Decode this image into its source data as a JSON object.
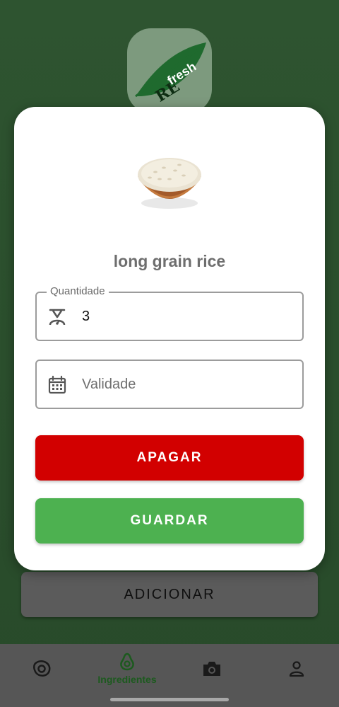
{
  "modal": {
    "item_name": "long grain rice",
    "quantity_label": "Quantidade",
    "quantity_value": "3",
    "expiry_placeholder": "Validade",
    "delete_label": "APAGAR",
    "save_label": "GUARDAR"
  },
  "background": {
    "logo_text": "REfresh",
    "add_label": "ADICIONAR"
  },
  "bottom_nav": {
    "items": [
      {
        "icon": "egg-icon",
        "label": ""
      },
      {
        "icon": "avocado-icon",
        "label": "Ingredientes",
        "active": true
      },
      {
        "icon": "camera-icon",
        "label": ""
      },
      {
        "icon": "person-icon",
        "label": ""
      }
    ]
  },
  "colors": {
    "background_green": "#2e5430",
    "delete_red": "#d20000",
    "save_green": "#4db150",
    "nav_active": "#1c5a1e"
  }
}
